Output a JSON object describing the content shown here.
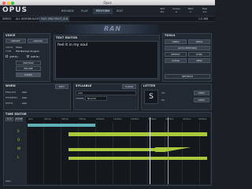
{
  "window": {
    "title": "Opus"
  },
  "header": {
    "logo": "OPUS",
    "nav": [
      "BROWSE",
      "PLAY",
      "PERFORM",
      "EDIT"
    ],
    "active_nav": "PERFORM",
    "stats": [
      {
        "label": "CPU",
        "value": "8%"
      },
      {
        "label": "Voices",
        "value": "0"
      },
      {
        "label": "MIDI",
        "value": "1"
      },
      {
        "label": "Disk",
        "value": "0.0"
      }
    ]
  },
  "subbar": {
    "items": [
      "SERIES",
      "ALL WORDBUILDER",
      "HW1 HW2 MULTI_SLB"
    ],
    "right": "1.0.368"
  },
  "banner": {
    "text": "RAN"
  },
  "voice_panel": {
    "title": "VOICE",
    "buttons_top": [
      "PRESET",
      "ASSIGN"
    ],
    "rows": [
      {
        "label": "VOICE",
        "value": "Voice"
      },
      {
        "label": "TYPE",
        "value": "HW Bankup Singers"
      }
    ],
    "toggles": [
      "(OPUS)",
      "(OPUS)"
    ],
    "buttons_bottom": [
      "PREVIEW",
      "ENGINE",
      "MIXER"
    ]
  },
  "text_editor": {
    "title": "TEXT EDITOR",
    "text": "feel it in my soul"
  },
  "tools": {
    "title": "TOOLS",
    "buttons": [
      "UNDO",
      "REDO",
      "AUTO PERFORM",
      "REPEAT",
      "SYNC",
      "CLEAR",
      "NEW",
      "REFRESH"
    ]
  },
  "word": {
    "title": "WORD",
    "button": "EDIT",
    "rows": [
      {
        "label": "ENGLISH",
        "value": "soul"
      },
      {
        "label": "PHONETIC",
        "value": "soul"
      },
      {
        "label": "PATHS",
        "value": "soul"
      }
    ]
  },
  "syllable": {
    "title": "SYLLABLE",
    "button": "CLEAR",
    "value": "soul",
    "mode_label": "VOWEL",
    "mode": "Normal"
  },
  "letter": {
    "title": "LETTER",
    "letter": "S",
    "row1_label": "Stv",
    "row1_btn": "APPLY",
    "row2_label": "Db",
    "row2_btn": "APPLY"
  },
  "timeline": {
    "title": "TIME EDITOR",
    "controls": [
      "PLAY",
      "ZOOM"
    ],
    "ticks": [
      "0ms",
      "250ms",
      "500ms",
      "750ms",
      "1000ms",
      "1250ms",
      "1500ms",
      "1750ms",
      "2000ms",
      "2250ms",
      "2500ms"
    ],
    "lanes": [
      "S",
      "O",
      "W",
      "L"
    ],
    "status": "MIDI"
  },
  "colors": {
    "accent_green": "#a9c83c",
    "accent_teal": "#5fb0b7",
    "nav_active": "#2f3a48"
  }
}
